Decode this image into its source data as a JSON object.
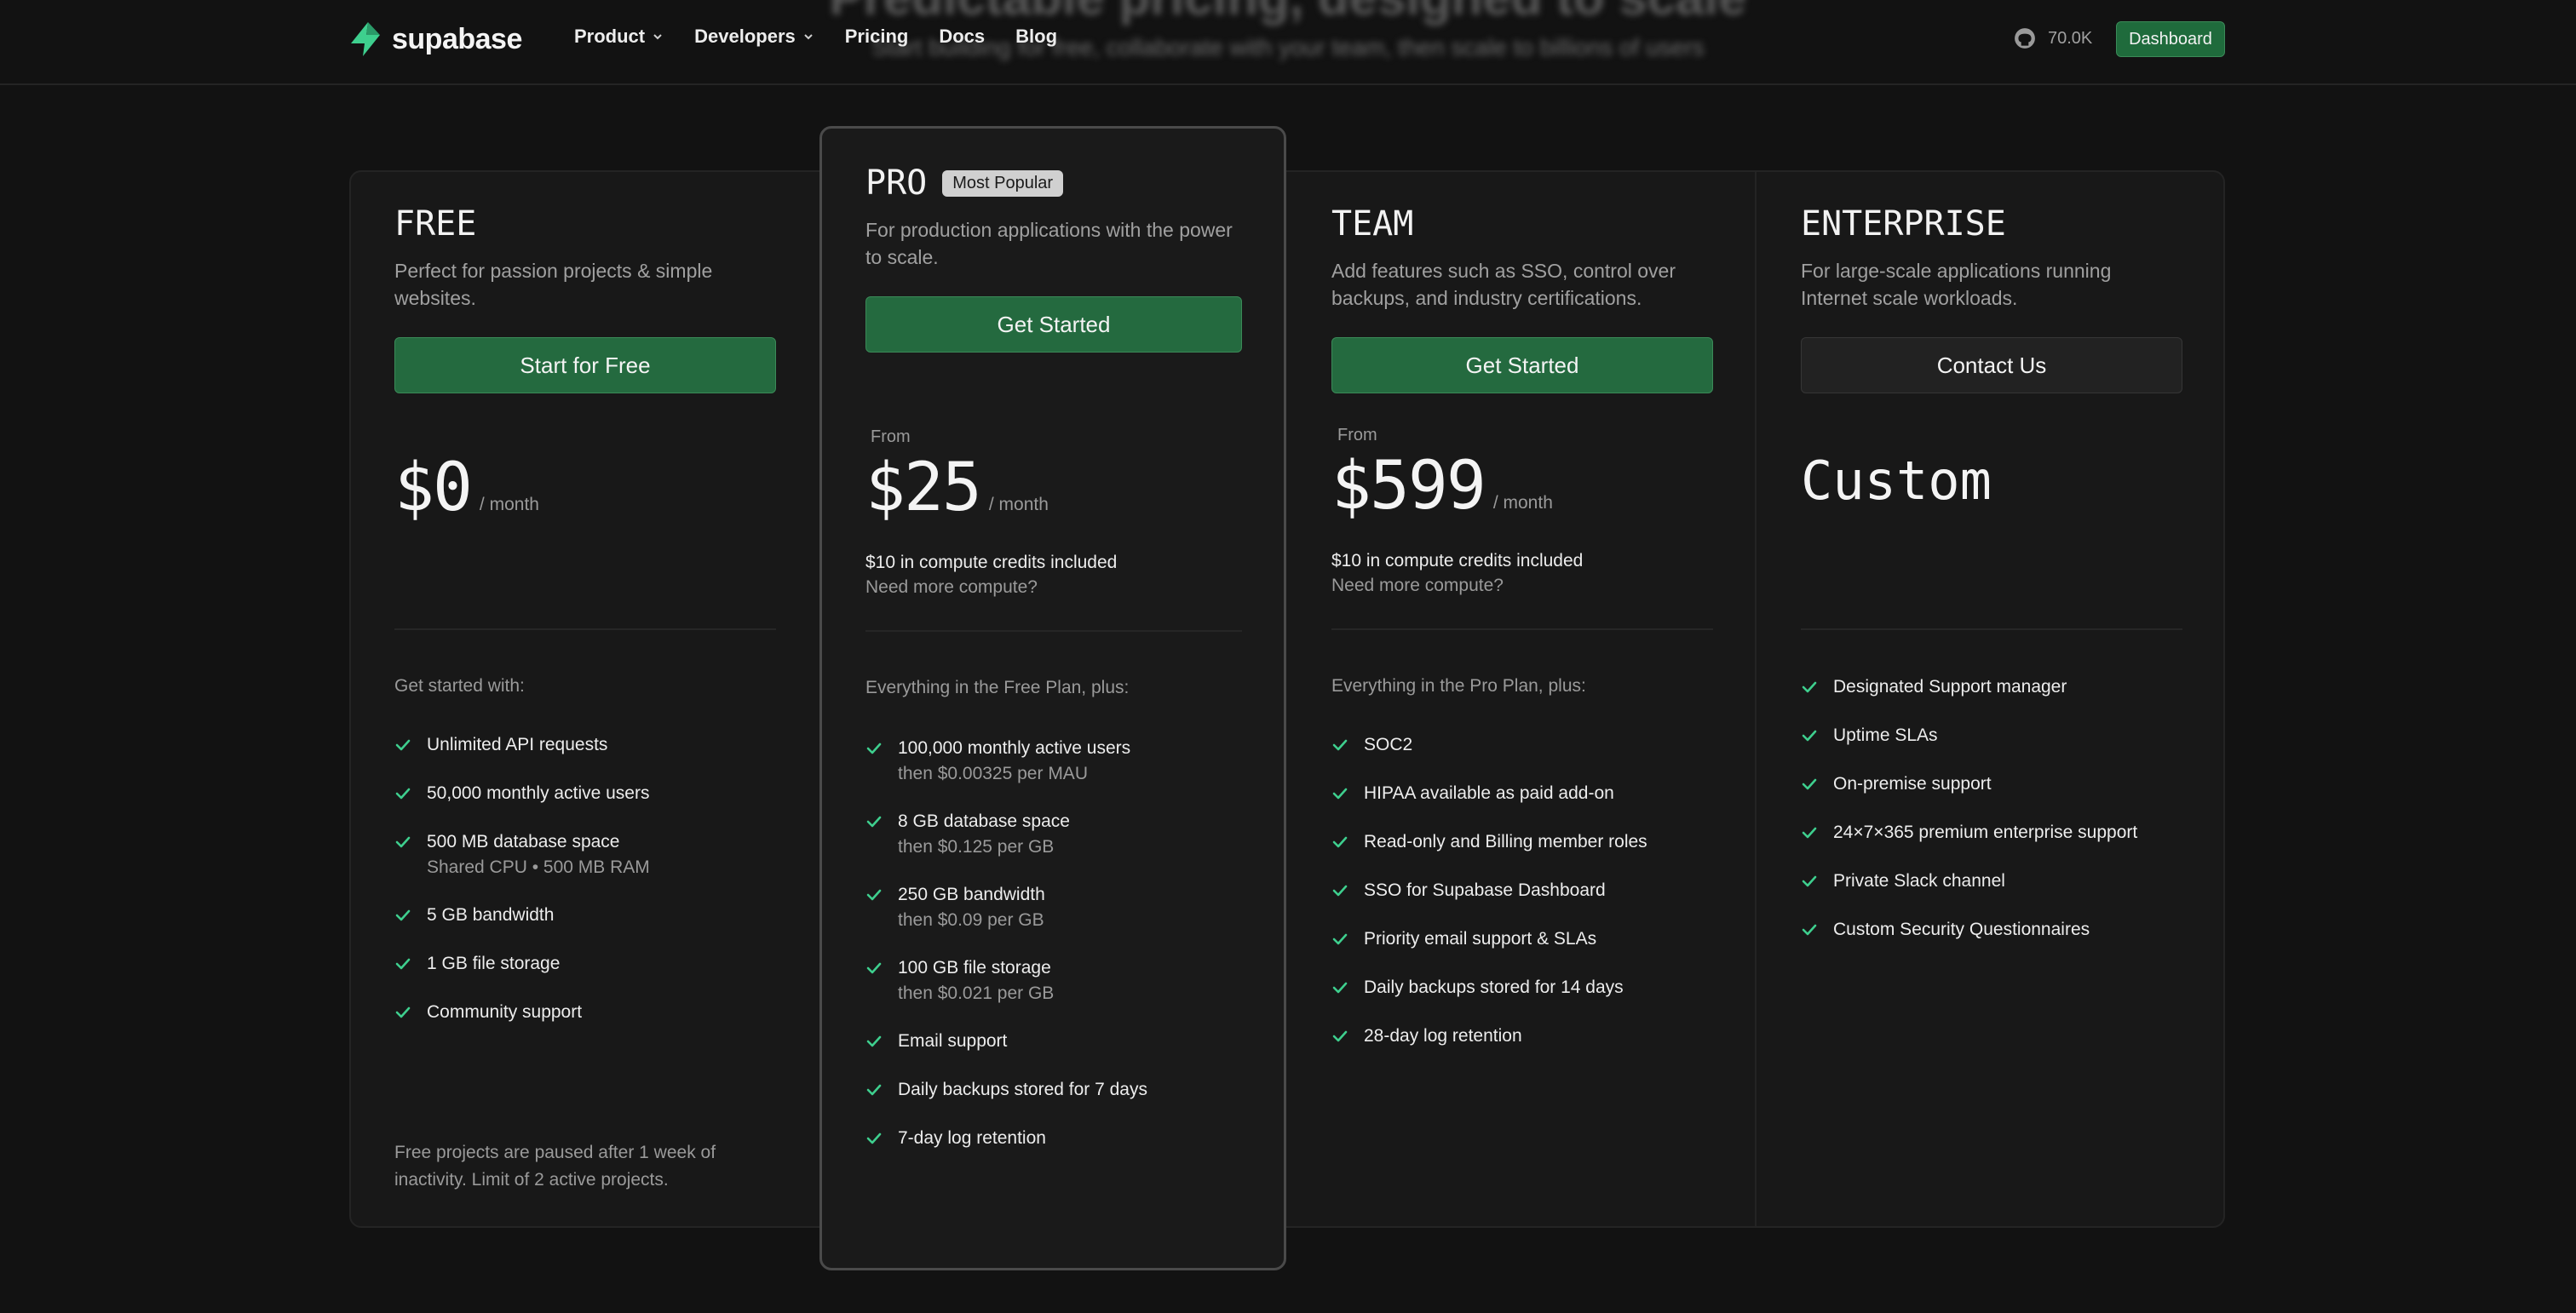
{
  "hero": {
    "title": "Predictable pricing, designed to scale",
    "subtitle": "Start building for free, collaborate with your team, then scale to billions of users"
  },
  "nav": {
    "brand": "supabase",
    "items": [
      {
        "label": "Product",
        "dropdown": true
      },
      {
        "label": "Developers",
        "dropdown": true
      },
      {
        "label": "Pricing",
        "dropdown": false
      },
      {
        "label": "Docs",
        "dropdown": false
      },
      {
        "label": "Blog",
        "dropdown": false
      }
    ],
    "github_stars": "70.0K",
    "dashboard_label": "Dashboard"
  },
  "colors": {
    "accent": "#3ecf8e",
    "button_green": "#246a3f",
    "background": "#121212"
  },
  "plans": {
    "free": {
      "name": "FREE",
      "description": "Perfect for passion projects & simple websites.",
      "cta": "Start for Free",
      "price": "$0",
      "period": "/ month",
      "list_heading": "Get started with:",
      "features": [
        {
          "text": "Unlimited API requests",
          "sub": ""
        },
        {
          "text": "50,000 monthly active users",
          "sub": ""
        },
        {
          "text": "500 MB database space",
          "sub": "Shared CPU • 500 MB RAM"
        },
        {
          "text": "5 GB bandwidth",
          "sub": ""
        },
        {
          "text": "1 GB file storage",
          "sub": ""
        },
        {
          "text": "Community support",
          "sub": ""
        }
      ],
      "footnote": "Free projects are paused after 1 week of inactivity. Limit of 2 active projects."
    },
    "pro": {
      "name": "PRO",
      "badge": "Most Popular",
      "description": "For production applications with the power to scale.",
      "cta": "Get Started",
      "from": "From",
      "price": "$25",
      "period": "/ month",
      "credits": "$10 in compute credits included",
      "more": "Need more compute?",
      "list_heading": "Everything in the Free Plan, plus:",
      "features": [
        {
          "text": "100,000 monthly active users",
          "sub": "then $0.00325 per MAU"
        },
        {
          "text": "8 GB database space",
          "sub": "then $0.125 per GB"
        },
        {
          "text": "250 GB bandwidth",
          "sub": "then $0.09 per GB"
        },
        {
          "text": "100 GB file storage",
          "sub": "then $0.021 per GB"
        },
        {
          "text": "Email support",
          "sub": ""
        },
        {
          "text": "Daily backups stored for 7 days",
          "sub": ""
        },
        {
          "text": "7-day log retention",
          "sub": ""
        }
      ]
    },
    "team": {
      "name": "TEAM",
      "description": "Add features such as SSO, control over backups, and industry certifications.",
      "cta": "Get Started",
      "from": "From",
      "price": "$599",
      "period": "/ month",
      "credits": "$10 in compute credits included",
      "more": "Need more compute?",
      "list_heading": "Everything in the Pro Plan, plus:",
      "features": [
        {
          "text": "SOC2",
          "sub": ""
        },
        {
          "text": "HIPAA available as paid add-on",
          "sub": ""
        },
        {
          "text": "Read-only and Billing member roles",
          "sub": ""
        },
        {
          "text": "SSO for Supabase Dashboard",
          "sub": ""
        },
        {
          "text": "Priority email support & SLAs",
          "sub": ""
        },
        {
          "text": "Daily backups stored for 14 days",
          "sub": ""
        },
        {
          "text": "28-day log retention",
          "sub": ""
        }
      ]
    },
    "enterprise": {
      "name": "ENTERPRISE",
      "description": "For large-scale applications running Internet scale workloads.",
      "cta": "Contact Us",
      "price": "Custom",
      "features": [
        {
          "text": "Designated Support manager",
          "sub": ""
        },
        {
          "text": "Uptime SLAs",
          "sub": ""
        },
        {
          "text": "On-premise support",
          "sub": ""
        },
        {
          "text": "24×7×365 premium enterprise support",
          "sub": ""
        },
        {
          "text": "Private Slack channel",
          "sub": ""
        },
        {
          "text": "Custom Security Questionnaires",
          "sub": ""
        }
      ]
    }
  }
}
